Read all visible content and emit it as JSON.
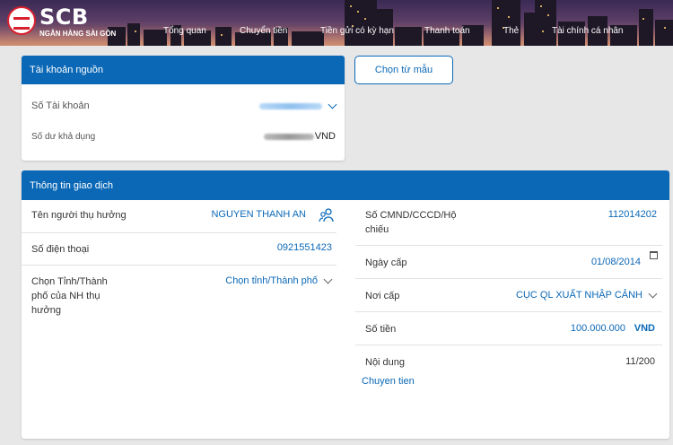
{
  "brand": {
    "name": "SCB",
    "subtitle": "NGÂN HÀNG SÀI GÒN"
  },
  "nav": [
    "Tổng quan",
    "Chuyển tiền",
    "Tiền gửi có kỳ hạn",
    "Thanh toán",
    "Thẻ",
    "Tài chính cá nhân"
  ],
  "source_account": {
    "title": "Tài khoản nguồn",
    "account_label": "Số Tài khoản",
    "balance_label": "Số dư khả dụng",
    "balance_currency": "VND"
  },
  "template_button": "Chọn từ mẫu",
  "transaction": {
    "title": "Thông tin giao dịch",
    "beneficiary_label": "Tên người thụ hưởng",
    "beneficiary_value": "NGUYEN THANH AN",
    "phone_label": "Số điện thoại",
    "phone_value": "0921551423",
    "province_label": "Chọn Tỉnh/Thành phố của NH thụ hưởng",
    "province_placeholder": "Chọn tỉnh/Thành phố",
    "id_label": "Số CMND/CCCD/Hộ chiếu",
    "id_value": "112014202",
    "issue_date_label": "Ngày cấp",
    "issue_date_value": "01/08/2014",
    "issue_place_label": "Nơi cấp",
    "issue_place_value": "CỤC QL XUẤT NHẬP CẢNH",
    "amount_label": "Số tiền",
    "amount_value": "100.000.000",
    "amount_currency": "VND",
    "content_label": "Nội dung",
    "content_counter": "11/200",
    "content_value": "Chuyen tien"
  },
  "colors": {
    "primary": "#0b68b6",
    "background": "#e7e7e7",
    "brand_red": "#d8202e"
  },
  "icons": {
    "beneficiary_contacts": "people-icon",
    "date_picker": "calendar-icon",
    "dropdown": "chevron-down-icon"
  }
}
